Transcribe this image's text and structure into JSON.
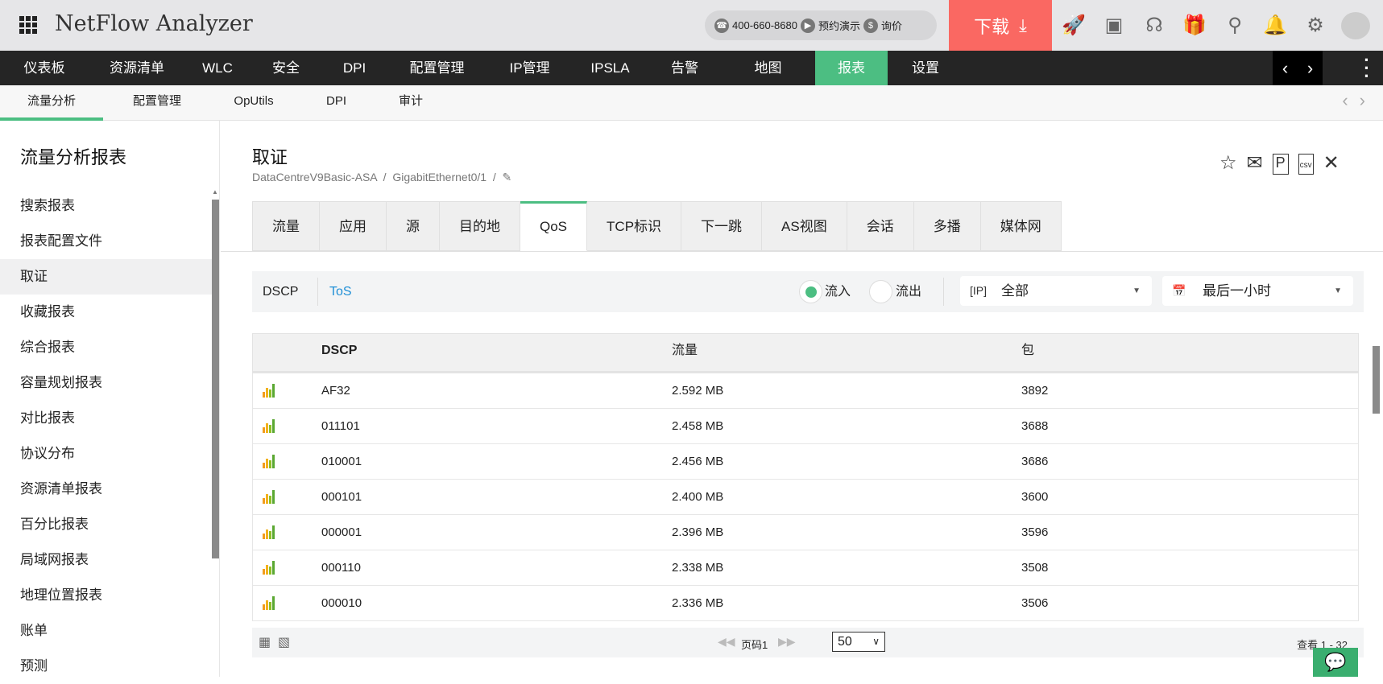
{
  "header": {
    "app_title": "NetFlow Analyzer",
    "phone": "400-660-8680",
    "demo": "预约演示",
    "price": "询价",
    "download": "下载"
  },
  "main_nav": [
    "仪表板",
    "资源清单",
    "WLC",
    "安全",
    "DPI",
    "配置管理",
    "IP管理",
    "IPSLA",
    "告警",
    "地图",
    "报表",
    "设置"
  ],
  "sub_nav": [
    "流量分析",
    "配置管理",
    "OpUtils",
    "DPI",
    "审计"
  ],
  "sidebar": {
    "title": "流量分析报表",
    "items": [
      "搜索报表",
      "报表配置文件",
      "取证",
      "收藏报表",
      "综合报表",
      "容量规划报表",
      "对比报表",
      "协议分布",
      "资源清单报表",
      "百分比报表",
      "局域网报表",
      "地理位置报表",
      "账单",
      "预测"
    ]
  },
  "page": {
    "title": "取证",
    "breadcrumb": [
      "DataCentreV9Basic-ASA",
      "GigabitEthernet0/1"
    ]
  },
  "tabs": [
    "流量",
    "应用",
    "源",
    "目的地",
    "QoS",
    "TCP标识",
    "下一跳",
    "AS视图",
    "会话",
    "多播",
    "媒体网"
  ],
  "filter": {
    "dscp": "DSCP",
    "tos": "ToS",
    "in": "流入",
    "out": "流出",
    "ip_select": "全部",
    "time_select": "最后一小时"
  },
  "table": {
    "headers": [
      "DSCP",
      "流量",
      "包"
    ],
    "rows": [
      [
        "AF32",
        "2.592 MB",
        "3892"
      ],
      [
        "011101",
        "2.458 MB",
        "3688"
      ],
      [
        "010001",
        "2.456 MB",
        "3686"
      ],
      [
        "000101",
        "2.400 MB",
        "3600"
      ],
      [
        "000001",
        "2.396 MB",
        "3596"
      ],
      [
        "000110",
        "2.338 MB",
        "3508"
      ],
      [
        "000010",
        "2.336 MB",
        "3506"
      ]
    ]
  },
  "footer": {
    "page_label": "页码1",
    "page_size": "50",
    "view_range": "查看 1 - 32"
  },
  "colors": {
    "accent": "#4cbe82",
    "download": "#fa6862"
  }
}
